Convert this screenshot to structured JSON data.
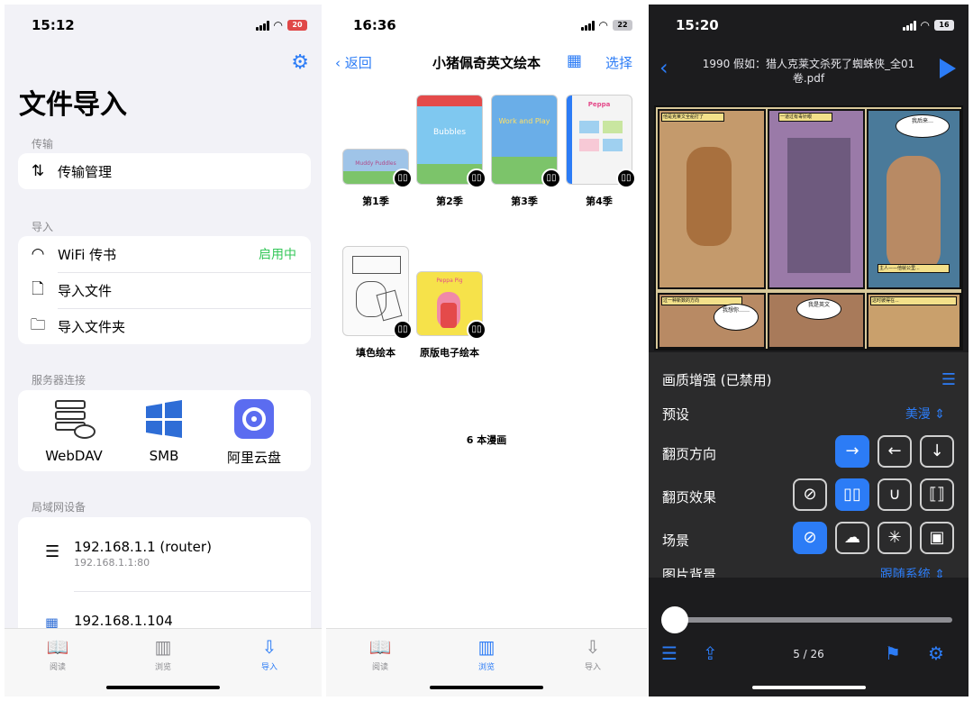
{
  "panel1": {
    "status": {
      "time": "15:12",
      "battery": "20"
    },
    "title": "文件导入",
    "sections": {
      "transfer": "传输",
      "import": "导入",
      "server": "服务器连接",
      "lan": "局域网设备"
    },
    "transfer_item": "传输管理",
    "import_items": [
      {
        "label": "WiFi 传书",
        "status": "启用中"
      },
      {
        "label": "导入文件"
      },
      {
        "label": "导入文件夹"
      }
    ],
    "servers": [
      "WebDAV",
      "SMB",
      "阿里云盘"
    ],
    "devices": [
      {
        "name": "192.168.1.1 (router)",
        "addr": "192.168.1.1:80"
      },
      {
        "name": "192.168.1.104"
      }
    ],
    "tabs": [
      "阅读",
      "浏览",
      "导入"
    ]
  },
  "panel2": {
    "status": {
      "time": "16:36",
      "battery": "22"
    },
    "back": "返回",
    "title": "小猪佩奇英文绘本",
    "select": "选择",
    "books": [
      {
        "label": "第1季",
        "cover_text": "Muddy Puddles",
        "color": "#9fc4e8"
      },
      {
        "label": "第2季",
        "cover_text": "Bubbles",
        "color": "#7fc8f0"
      },
      {
        "label": "第3季",
        "cover_text": "Work and Play",
        "color": "#6aaee8"
      },
      {
        "label": "第4季",
        "cover_text": "Peppa",
        "color": "#f4f4f4"
      },
      {
        "label": "填色绘本",
        "cover_text": "",
        "color": "#fafafa"
      },
      {
        "label": "原版电子绘本",
        "cover_text": "Peppa Pig",
        "color": "#f6e24a"
      }
    ],
    "count": "6 本漫画",
    "tabs": [
      "阅读",
      "浏览",
      "导入"
    ]
  },
  "panel3": {
    "status": {
      "time": "15:20",
      "battery": "16"
    },
    "file_title": "1990 假如：猎人克莱文杀死了蜘蛛侠_全01卷.pdf",
    "comic_captions": [
      "他是克莱文全船打了",
      "一道过有毒针眼",
      "在兰布",
      "主人——他就公里...",
      "过一种新数的方向",
      "这时彼得在..."
    ],
    "comic_bubbles": [
      "我后来…",
      "我想你……",
      "我是英文",
      "我是英文…"
    ],
    "settings": {
      "quality": "画质增强 (已禁用)",
      "preset_label": "预设",
      "preset_value": "美漫",
      "direction_label": "翻页方向",
      "effect_label": "翻页效果",
      "scene_label": "场景",
      "bg_label": "图片背景",
      "bg_value": "跟随系统"
    },
    "page": "5 / 26",
    "progress": 0.05
  }
}
